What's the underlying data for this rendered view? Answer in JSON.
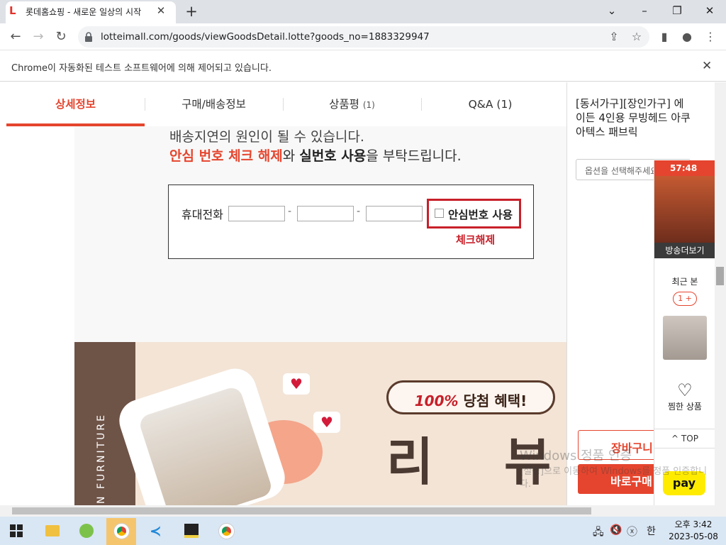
{
  "browser": {
    "tab_title": "롯데홈쇼핑 - 새로운 일상의 시작",
    "url": "lotteimall.com/goods/viewGoodsDetail.lotte?goods_no=1883329947",
    "infobar_text": "Chrome이 자동화된 테스트 소프트웨어에 의해 제어되고 있습니다."
  },
  "detail_tabs": [
    {
      "label": "상세정보",
      "count": ""
    },
    {
      "label": "구매/배송정보",
      "count": ""
    },
    {
      "label": "상품평",
      "count": "(1)"
    },
    {
      "label": "Q&A",
      "count": "(1)"
    }
  ],
  "content": {
    "line1": "배송지연의 원인이 될 수 있습니다.",
    "line2_red": "안심 번호 체크 해제",
    "line2_mid": "와 ",
    "line2_bold": "실번호 사용",
    "line2_end": "을 부탁드립니다.",
    "phone_label": "휴대전화",
    "dash": "-",
    "safe_number_label": "안심번호 사용",
    "uncheck_label": "체크해제"
  },
  "banner": {
    "vertical_text": "N FURNITURE",
    "pill_pct": "100%",
    "pill_text": " 당첨 혜택!",
    "big_char_1": "리",
    "big_char_2": "뷰"
  },
  "right_panel": {
    "product_title": "[동서가구][장인가구] 에이든 4인용 무빙헤드 아쿠아텍스 패브릭",
    "option_placeholder": "옵션을 선택해주세요",
    "cart_button": "장바구니",
    "buy_button": "바로구매"
  },
  "floating": {
    "live_time": "57:48",
    "live_button": "방송더보기",
    "recent_label": "최근 본",
    "recent_count": "1 +",
    "wish_label": "찜한 상품",
    "top_label": "TOP",
    "pay_label": "pay"
  },
  "watermark": {
    "line1": "Windows 정품 인증",
    "line2": "[설정]으로 이동하여 Windows를 정품 인증합니다."
  },
  "taskbar": {
    "time": "오후 3:42",
    "date": "2023-05-08",
    "ime": "한"
  },
  "colors": {
    "accent": "#e5452e",
    "highlight_border": "#c8202a"
  }
}
